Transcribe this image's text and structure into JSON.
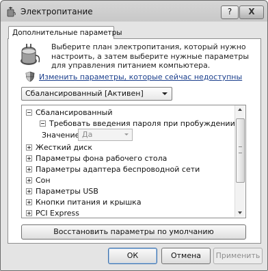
{
  "window": {
    "title": "Электропитание",
    "help_label": "?",
    "close_label": "X"
  },
  "tab": {
    "label": "Дополнительные параметры"
  },
  "description": "Выберите план электропитания, который нужно настроить, а затем выберите нужные параметры для управления питанием компьютера.",
  "change_link": "Изменить параметры, которые сейчас недоступны",
  "plan_select": {
    "value": "Сбалансированный [Активен]"
  },
  "tree": {
    "root": "Сбалансированный",
    "child": "Требовать введения пароля при пробуждении",
    "value_label": "Значение:",
    "value": "Да",
    "items": [
      "Жесткий диск",
      "Параметры фона рабочего стола",
      "Параметры адаптера беспроводной сети",
      "Сон",
      "Параметры USB",
      "Кнопки питания и крышка",
      "PCI Express"
    ]
  },
  "restore_button": "Восстановить параметры по умолчанию",
  "buttons": {
    "ok": "ОК",
    "cancel": "Отмена",
    "apply": "Применить"
  }
}
